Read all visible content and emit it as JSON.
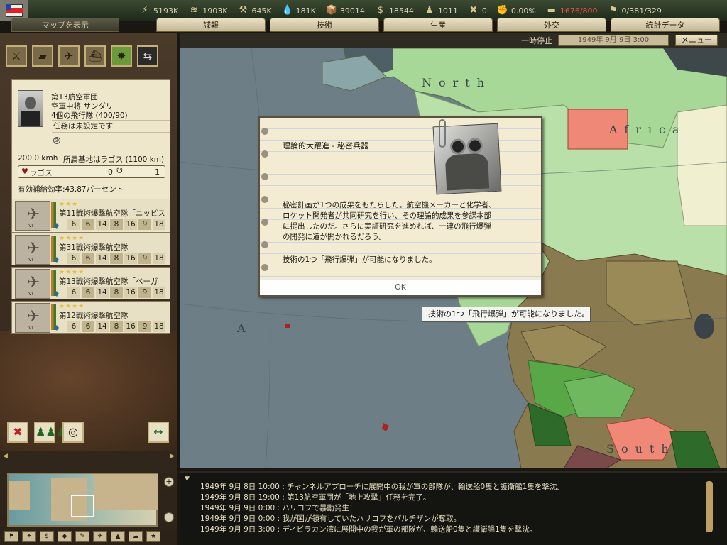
{
  "resources": [
    {
      "icon": "energy-icon",
      "glyph": "⚡",
      "value": "5193K"
    },
    {
      "icon": "metal-icon",
      "glyph": "≋",
      "value": "1903K"
    },
    {
      "icon": "rare-materials-icon",
      "glyph": "⚒",
      "value": "645K"
    },
    {
      "icon": "oil-icon",
      "glyph": "💧",
      "value": "181K"
    },
    {
      "icon": "supplies-icon",
      "glyph": "📦",
      "value": "39014"
    },
    {
      "icon": "money-icon",
      "glyph": "$",
      "value": "18544"
    },
    {
      "icon": "manpower-icon",
      "glyph": "♟",
      "value": "1011"
    },
    {
      "icon": "transport-icon",
      "glyph": "✖",
      "value": "0"
    },
    {
      "icon": "dissent-icon",
      "glyph": "✊",
      "value": "0.00%"
    },
    {
      "icon": "convoy-icon",
      "glyph": "▬",
      "value": "1676/800"
    },
    {
      "icon": "victory-points-icon",
      "glyph": "⚑",
      "value": "0/381/329"
    }
  ],
  "tabs": [
    "マップを表示",
    "諜報",
    "技術",
    "生産",
    "外交",
    "統計データ"
  ],
  "status": {
    "pause": "一時停止",
    "date": "1949年 9月 9日 3:00",
    "menu": "メニュー"
  },
  "unit": {
    "name": "第13航空軍団",
    "commander": "空軍中将 サンダリ",
    "wings": "4個の飛行隊 (400/90)",
    "mission": "任務は未設定です",
    "speed": "200.0 kmh",
    "base_info": "所属基地はラゴス (1100 km)",
    "base_name": "ラゴス",
    "base_n0": "0",
    "base_n1": "1",
    "supply": "有効補給効率:43.87パーセント"
  },
  "wings": [
    {
      "stars": "★★★",
      "name": "第11戦術爆撃航空隊「ニッピス",
      "stats": [
        "6",
        "6",
        "14",
        "8",
        "16",
        "9",
        "18"
      ]
    },
    {
      "stars": "★★★★",
      "name": "第31戦術爆撃航空隊",
      "stats": [
        "6",
        "6",
        "14",
        "8",
        "16",
        "9",
        "18"
      ]
    },
    {
      "stars": "★★★★",
      "name": "第13戦術爆撃航空隊「ベーガ",
      "stats": [
        "6",
        "6",
        "14",
        "8",
        "16",
        "9",
        "18"
      ]
    },
    {
      "stars": "★★★★",
      "name": "第12戦術爆撃航空隊",
      "stats": [
        "6",
        "6",
        "14",
        "8",
        "16",
        "9",
        "18"
      ]
    }
  ],
  "event": {
    "title": "理論的大躍進 - 秘密兵器",
    "body": "秘密計画が1つの成果をもたらした。航空機メーカーと化学者、\nロケット開発者が共同研究を行い、その理論的成果を参謀本部\nに提出したのだ。さらに実証研究を進めれば、一連の飛行爆弾\nの開発に道が開かれるだろう。",
    "result": "技術の1つ「飛行爆弾」が可能になりました。",
    "ok": "OK"
  },
  "tooltip": "技術の1つ「飛行爆弾」が可能になりました。",
  "map_labels": {
    "north": "North",
    "atlantic": "A",
    "south": "South",
    "africa": "Africa"
  },
  "log": [
    "1949年 9月 8日 10:00 : チャンネルアプローチに展開中の我が軍の部隊が、輸送船0隻と護衛艦1隻を撃沈。",
    "1949年 9月 8日 19:00 : 第13航空軍団が「地上攻撃」任務を完了。",
    "1949年 9月 9日 0:00 : ハリコフで暴動発生！",
    "1949年 9月 9日 0:00 : 我が国が領有していたハリコフをパルチザンが奪取。",
    "1949年 9月 9日 3:00 : ディビラカン湾に展開中の我が軍の部隊が、輸送船0隻と護衛艦1隻を撃沈。"
  ],
  "colors": {
    "neutral_green": "#a8d898",
    "ally_green": "#58a848",
    "enemy_red": "#f08878",
    "territory": "#8a7a50",
    "sea": "#6e7e86"
  }
}
